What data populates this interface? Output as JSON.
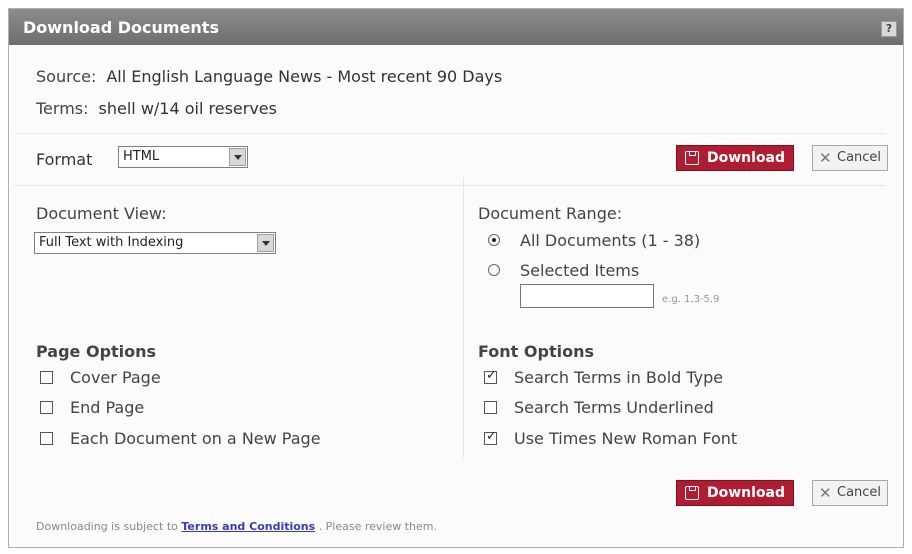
{
  "dialog": {
    "title": "Download Documents",
    "help": "?"
  },
  "source": {
    "label": "Source:",
    "value": "All English Language News - Most recent 90 Days"
  },
  "terms": {
    "label": "Terms:",
    "value": "shell w/14 oil reserves"
  },
  "format": {
    "label": "Format",
    "selected": "HTML"
  },
  "buttons": {
    "download": "Download",
    "cancel": "Cancel"
  },
  "document_view": {
    "title": "Document View:",
    "selected": "Full Text with Indexing"
  },
  "document_range": {
    "title": "Document Range:",
    "all": "All Documents (1 - 38)",
    "selected_items": "Selected Items",
    "example": "e.g. 1,3-5,9"
  },
  "page_options": {
    "title": "Page Options",
    "items": [
      {
        "label": "Cover Page",
        "checked": false
      },
      {
        "label": "End Page",
        "checked": false
      },
      {
        "label": "Each Document on a New Page",
        "checked": false
      }
    ]
  },
  "font_options": {
    "title": "Font Options",
    "items": [
      {
        "label": "Search Terms in Bold Type",
        "checked": true
      },
      {
        "label": "Search Terms Underlined",
        "checked": false
      },
      {
        "label": "Use Times New Roman Font",
        "checked": true
      }
    ]
  },
  "footer": {
    "prefix": "Downloading is subject to",
    "link": "Terms and Conditions",
    "suffix": ". Please review them."
  }
}
